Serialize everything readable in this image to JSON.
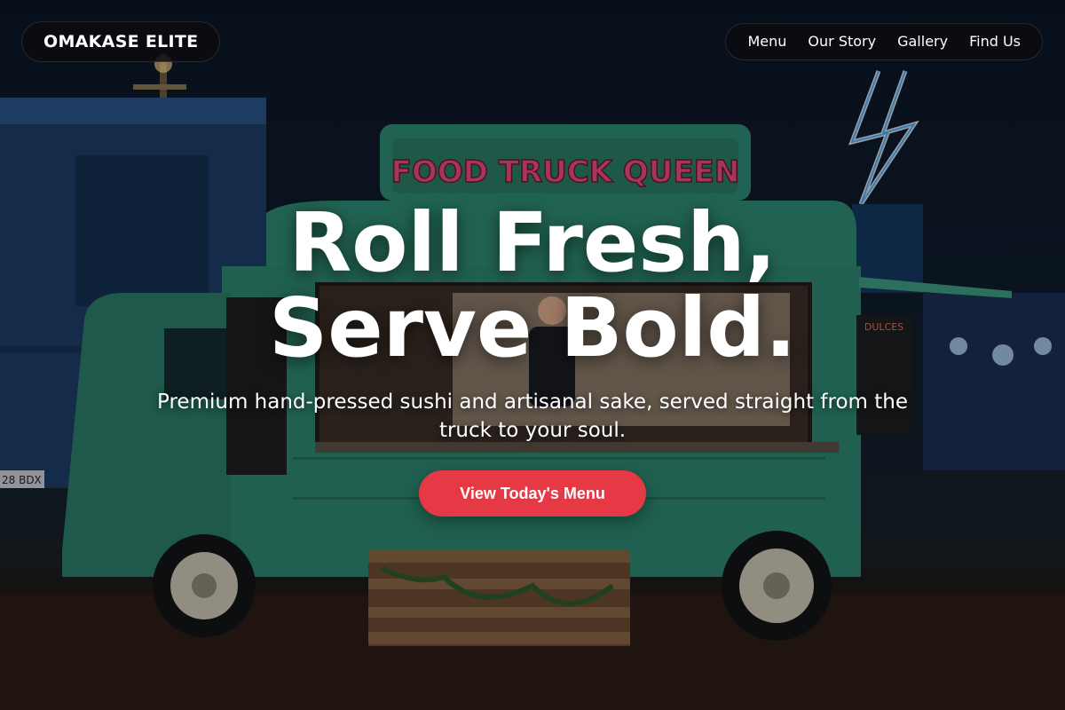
{
  "brand": {
    "name": "OMAKASE ELITE"
  },
  "nav": {
    "items": [
      {
        "label": "Menu"
      },
      {
        "label": "Our Story"
      },
      {
        "label": "Gallery"
      },
      {
        "label": "Find Us"
      }
    ]
  },
  "hero": {
    "headline_line1": "Roll Fresh,",
    "headline_line2": "Serve Bold.",
    "subtitle": "Premium hand-pressed sushi and artisanal sake, served straight from the truck to your soul.",
    "cta_label": "View Today's Menu",
    "truck_sign": "FOOD TRUCK QUEEN",
    "side_sign": "DULCES",
    "plate_text": "28 BDX"
  },
  "colors": {
    "accent": "#e63946",
    "truck": "#2f8a72",
    "nav_bg": "#0a0c10"
  }
}
